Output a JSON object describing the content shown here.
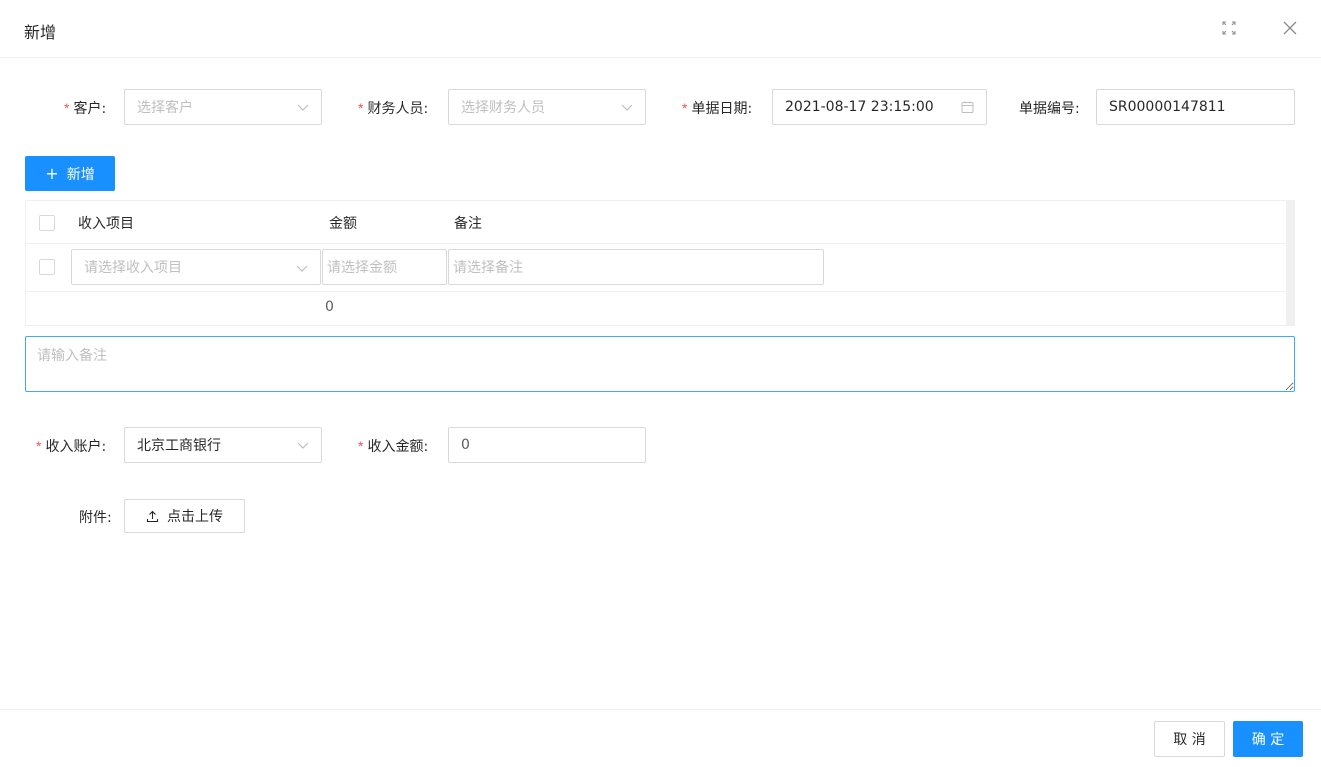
{
  "modal": {
    "title": "新增"
  },
  "icons": {
    "fullscreen": "fullscreen-icon",
    "close": "close-icon",
    "chevron": "chevron-down-icon",
    "calendar": "calendar-icon",
    "plus": "plus-icon",
    "upload": "upload-icon"
  },
  "form": {
    "customer": {
      "label": "客户:",
      "placeholder": "选择客户",
      "required": true
    },
    "finance_staff": {
      "label": "财务人员:",
      "placeholder": "选择财务人员",
      "required": true
    },
    "doc_date": {
      "label": "单据日期:",
      "value": "2021-08-17 23:15:00",
      "required": true
    },
    "doc_number": {
      "label": "单据编号:",
      "value": "SR00000147811"
    }
  },
  "add_button": {
    "label": "新增"
  },
  "table": {
    "headers": {
      "item": "收入项目",
      "amount": "金额",
      "note": "备注"
    },
    "row": {
      "item_placeholder": "请选择收入项目",
      "amount_placeholder": "请选择金额",
      "note_placeholder": "请选择备注"
    },
    "total": "0"
  },
  "remark": {
    "placeholder": "请输入备注"
  },
  "account": {
    "label": "收入账户:",
    "value": "北京工商银行",
    "required": true
  },
  "income_amount": {
    "label": "收入金额:",
    "value": "0",
    "required": true
  },
  "attachment": {
    "label": "附件:",
    "upload_label": "点击上传"
  },
  "footer": {
    "cancel": "取 消",
    "confirm": "确 定"
  },
  "colors": {
    "primary": "#1890ff",
    "required": "#ff4d4f",
    "border": "#d9d9d9",
    "placeholder": "#bfbfbf"
  }
}
